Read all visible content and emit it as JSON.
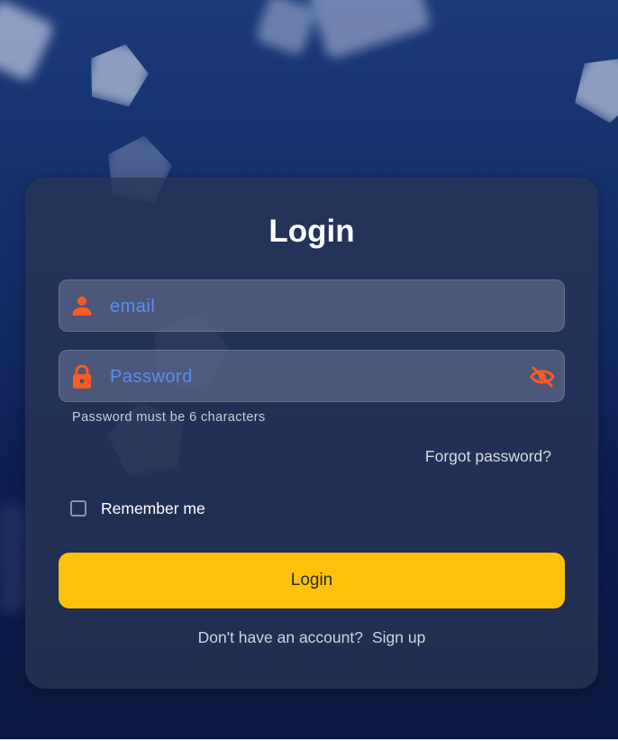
{
  "login": {
    "title": "Login",
    "email": {
      "placeholder": "email",
      "value": "",
      "icon": "person-icon"
    },
    "password": {
      "placeholder": "Password",
      "value": "",
      "icon": "lock-icon",
      "visibility_icon": "eye-off-icon"
    },
    "password_hint": "Password must be 6 characters",
    "forgot_password": "Forgot password?",
    "remember_me": {
      "label": "Remember me",
      "checked": false
    },
    "submit_label": "Login",
    "signup_prompt": "Don't have an account?",
    "signup_link": "Sign up"
  },
  "colors": {
    "accent_orange": "#ff5a24",
    "button_yellow": "#fec20d",
    "placeholder_blue": "#5a8ef0",
    "background": "#12296a"
  }
}
